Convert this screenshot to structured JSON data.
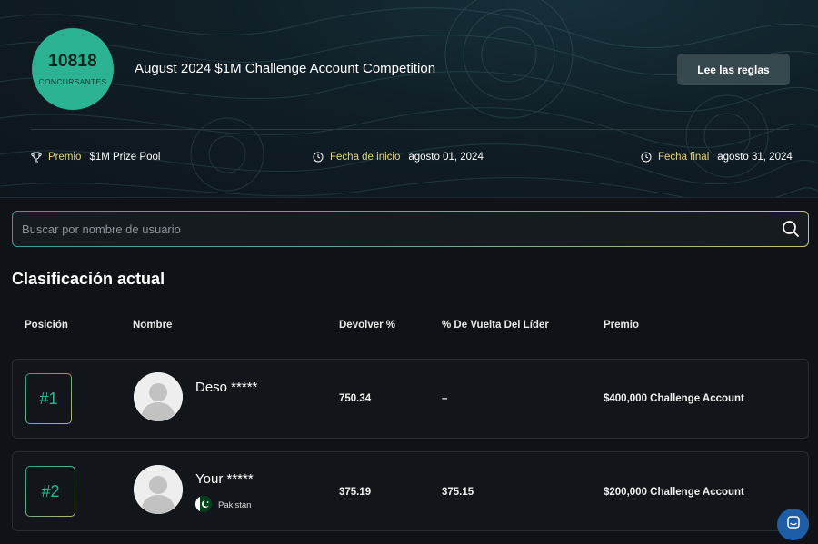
{
  "competition": {
    "participants_count": "10818",
    "participants_label": "CONCURSANTES",
    "title": "August 2024 $1M Challenge Account Competition",
    "rules_button": "Lee las reglas",
    "prize_label": "Premio",
    "prize_value": "$1M Prize Pool",
    "start_label": "Fecha de inicio",
    "start_value": "agosto 01, 2024",
    "end_label": "Fecha final",
    "end_value": "agosto 31, 2024"
  },
  "search": {
    "placeholder": "Buscar por nombre de usuario",
    "value": ""
  },
  "leaderboard": {
    "title": "Clasificación actual",
    "columns": [
      "Posición",
      "Nombre",
      "Devolver %",
      "% De Vuelta Del Líder",
      "Premio"
    ],
    "rows": [
      {
        "rank": "#1",
        "name": "Deso *****",
        "country": "",
        "return_pct": "750.34",
        "behind_leader": "–",
        "prize": "$400,000 Challenge Account"
      },
      {
        "rank": "#2",
        "name": "Your *****",
        "country": "Pakistan",
        "return_pct": "375.19",
        "behind_leader": "375.15",
        "prize": "$200,000 Challenge Account"
      }
    ]
  },
  "icons": [
    "trophy-icon",
    "clock-icon",
    "search-icon",
    "avatar-placeholder",
    "pakistan-flag-icon",
    "chat-icon"
  ],
  "colors": {
    "accent_teal": "#2bb394",
    "label_gold": "#e6d57a",
    "background": "#0f1217",
    "chat_blue": "#1e5ea8"
  }
}
